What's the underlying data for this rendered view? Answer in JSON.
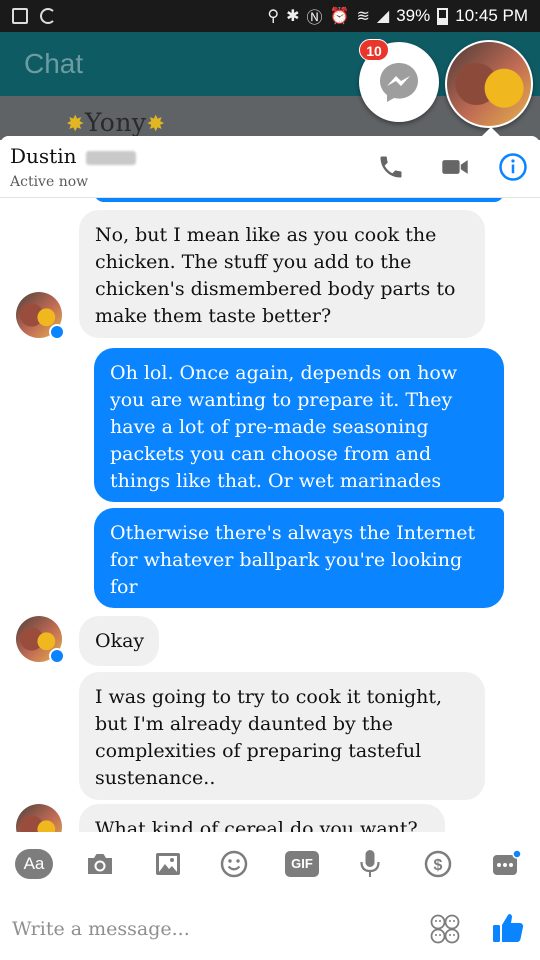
{
  "status_bar": {
    "battery": "39%",
    "time": "10:45 PM"
  },
  "background_app": {
    "title": "Chat",
    "contact_row_name": "Yony"
  },
  "chat_heads": {
    "unread_badge": "10"
  },
  "chat_header": {
    "contact_name": "Dustin",
    "status": "Active now"
  },
  "messages": [
    {
      "side": "received",
      "text": "No, but I mean like as you cook the chicken. The stuff you add to the chicken's dismembered body parts to make them taste better?"
    },
    {
      "side": "sent",
      "text": "Oh lol. Once again, depends on how you are wanting to prepare it. They have a lot of pre-made seasoning packets you can choose from and things like that. Or wet marinades"
    },
    {
      "side": "sent",
      "text": "Otherwise there's always the Internet for whatever ballpark you're looking for"
    },
    {
      "side": "received",
      "text": "Okay"
    },
    {
      "side": "received",
      "text": "I was going to try to cook it tonight, but I'm already daunted by the complexities of preparing tasteful sustenance.."
    },
    {
      "side": "received",
      "text": "What kind of cereal do you want?"
    }
  ],
  "toolbar": {
    "text_style_label": "Aa",
    "gif_label": "GIF"
  },
  "composer": {
    "placeholder": "Write a message..."
  },
  "colors": {
    "accent": "#0a84ff",
    "received_bubble": "#f1f0f0",
    "background_header": "#0f5b64",
    "badge": "#e9352a"
  }
}
